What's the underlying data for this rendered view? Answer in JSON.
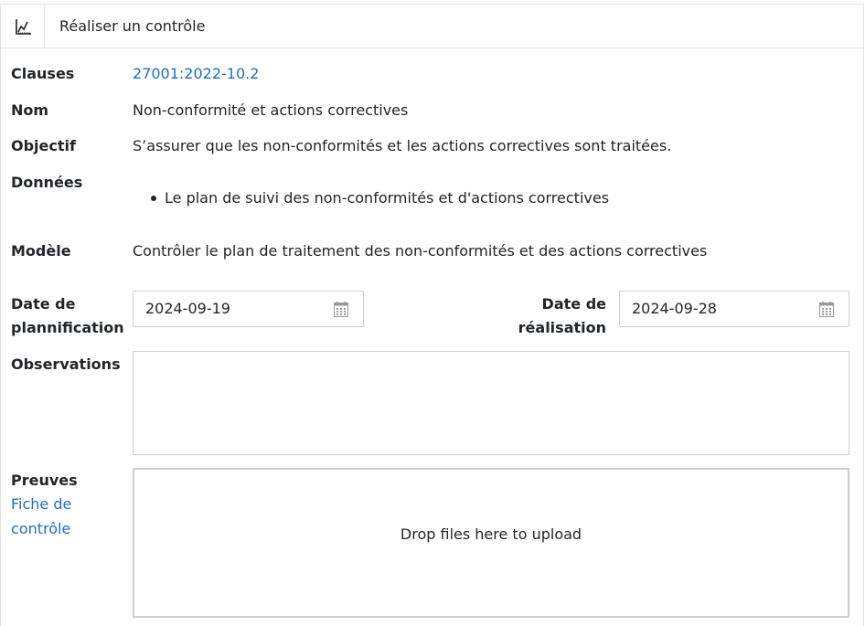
{
  "header": {
    "title": "Réaliser un contrôle",
    "icon": "chart-icon"
  },
  "fields": {
    "clauses": {
      "label": "Clauses",
      "value": "27001:2022-10.2"
    },
    "nom": {
      "label": "Nom",
      "value": "Non-conformité et actions correctives"
    },
    "objectif": {
      "label": "Objectif",
      "value": "S’assurer que les non-conformités et les actions correctives sont traitées."
    },
    "donnees": {
      "label": "Données",
      "items": [
        "Le plan de suivi des non-conformités et d'actions correctives"
      ]
    },
    "modele": {
      "label": "Modèle",
      "value": "Contrôler le plan de traitement des non-conformités et des actions correctives"
    },
    "planification": {
      "label_line1": "Date de",
      "label_line2": "plannification",
      "value": "2024-09-19"
    },
    "realisation": {
      "label_line1": "Date de",
      "label_line2": "réalisation",
      "value": "2024-09-28"
    },
    "observations": {
      "label": "Observations",
      "value": ""
    },
    "preuves": {
      "label": "Preuves",
      "link_line1": "Fiche de",
      "link_line2": "contrôle",
      "dropzone_text": "Drop files here to upload"
    }
  },
  "colors": {
    "link": "#1c6ec6",
    "border": "#cfcfcf"
  }
}
